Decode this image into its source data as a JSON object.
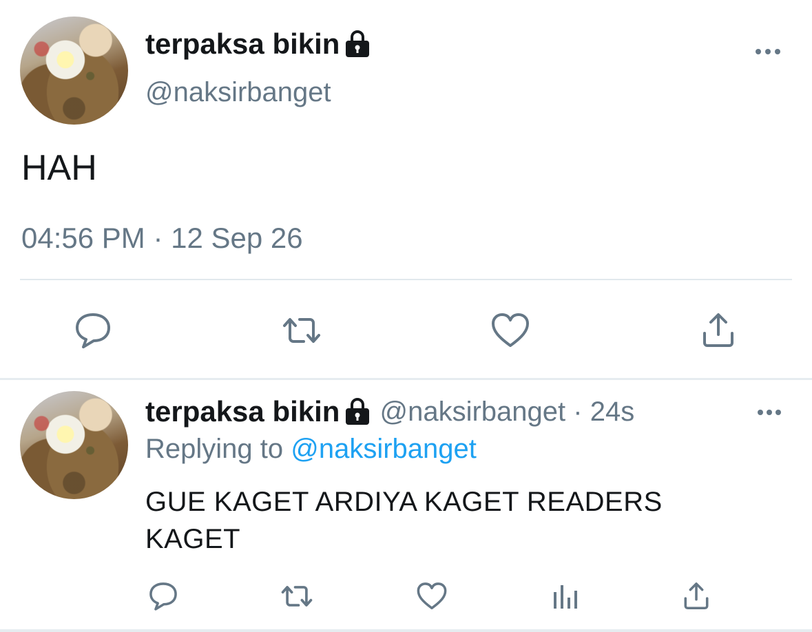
{
  "main_tweet": {
    "author": {
      "display_name": "terpaksa bikin",
      "handle": "@naksirbanget",
      "protected_icon": "lock-icon",
      "avatar": "fried-rice-egg-photo"
    },
    "text": "HAH",
    "timestamp": "04:56 PM · 12 Sep 26",
    "more_icon": "more-dots-icon",
    "actions": [
      {
        "name": "reply",
        "icon": "comment-icon"
      },
      {
        "name": "retweet",
        "icon": "retweet-icon"
      },
      {
        "name": "like",
        "icon": "heart-icon"
      },
      {
        "name": "share",
        "icon": "share-icon"
      }
    ]
  },
  "reply_tweet": {
    "author": {
      "display_name": "terpaksa bikin",
      "handle": "@naksirbanget",
      "protected_icon": "lock-icon",
      "avatar": "fried-rice-egg-photo"
    },
    "separator": "·",
    "time": "24s",
    "replying_prefix": "Replying to",
    "replying_to": "@naksirbanget",
    "text": "GUE KAGET ARDIYA KAGET READERS KAGET",
    "more_icon": "more-dots-icon",
    "actions": [
      {
        "name": "reply",
        "icon": "comment-icon"
      },
      {
        "name": "retweet",
        "icon": "retweet-icon"
      },
      {
        "name": "like",
        "icon": "heart-icon"
      },
      {
        "name": "analytics",
        "icon": "analytics-icon"
      },
      {
        "name": "share",
        "icon": "share-icon"
      }
    ]
  },
  "colors": {
    "text_primary": "#14171a",
    "text_secondary": "#657786",
    "link": "#1da1f2",
    "divider": "#e1e8ed"
  }
}
